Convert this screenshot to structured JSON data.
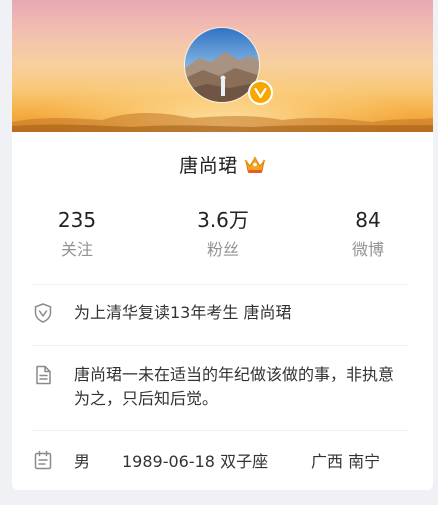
{
  "profile": {
    "name": "唐尚珺",
    "badge_icon": "crown-icon",
    "verified_icon": "verified-v-icon",
    "accent_color": "#f7a700"
  },
  "stats": [
    {
      "value": "235",
      "label": "关注"
    },
    {
      "value": "3.6万",
      "label": "粉丝"
    },
    {
      "value": "84",
      "label": "微博"
    }
  ],
  "info": {
    "verification": "为上清华复读13年考生 唐尚珺",
    "bio": "唐尚珺一未在适当的年纪做该做的事，非执意为之，只后知后觉。",
    "gender": "男",
    "birthday": "1989-06-18 双子座",
    "location": "广西 南宁"
  }
}
